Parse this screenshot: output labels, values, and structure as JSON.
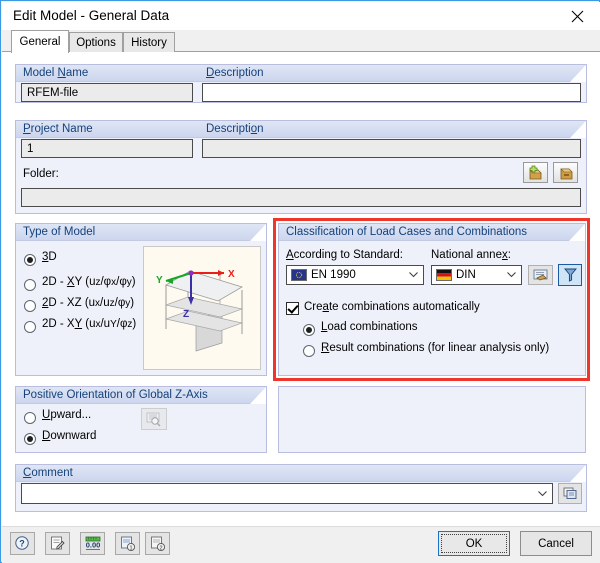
{
  "window": {
    "title": "Edit Model - General Data",
    "close_icon": "close-icon"
  },
  "tabs": [
    {
      "label": "General",
      "active": true
    },
    {
      "label": "Options",
      "active": false
    },
    {
      "label": "History",
      "active": false
    }
  ],
  "model": {
    "name_label": "Model Name",
    "name_value": "RFEM-file",
    "description_label": "Description",
    "description_value": ""
  },
  "project": {
    "name_label": "Project Name",
    "name_value": "1",
    "description_label": "Description",
    "description_value": "",
    "folder_label": "Folder:",
    "folder_value": "",
    "new_folder_icon": "new-folder-icon",
    "browse_folder_icon": "folder-box-icon"
  },
  "type_of_model": {
    "title": "Type of Model",
    "options": [
      {
        "label": "3D",
        "selected": true
      },
      {
        "label": "2D - XY (uz/φx/φy)",
        "selected": false
      },
      {
        "label": "2D - XZ (ux/uz/φy)",
        "selected": false
      },
      {
        "label": "2D - XY (ux/uy/φz)",
        "selected": false
      }
    ],
    "preview_axes": {
      "x": "X",
      "y": "Y",
      "z": "Z"
    }
  },
  "classification": {
    "title": "Classification of Load Cases and Combinations",
    "standard_label": "According to Standard:",
    "standard_value": "EN 1990",
    "standard_icon": "eu-flag-icon",
    "annex_label": "National annex:",
    "annex_value": "DIN",
    "annex_icon": "germany-flag-icon",
    "edit_annex_icon": "edit-annex-icon",
    "filter_icon": "filter-icon",
    "auto_checkbox_label": "Create combinations automatically",
    "auto_checked": true,
    "combination_options": [
      {
        "label": "Load combinations",
        "selected": true
      },
      {
        "label": "Result combinations (for linear analysis only)",
        "selected": false
      }
    ],
    "highlight_color": "#f0352c"
  },
  "z_axis": {
    "title": "Positive Orientation of Global Z-Axis",
    "options": [
      {
        "label": "Upward...",
        "selected": false
      },
      {
        "label": "Downward",
        "selected": true
      }
    ],
    "preview_icon": "preview-magnifier-icon"
  },
  "comment": {
    "label": "Comment",
    "value": "",
    "dropdown_icon": "chevron-down-icon",
    "library_icon": "comment-library-icon"
  },
  "footer": {
    "tools": [
      {
        "name": "help-icon",
        "glyph": "?"
      },
      {
        "name": "edit-note-icon",
        "glyph": "✎"
      },
      {
        "name": "units-icon",
        "glyph": "0.00"
      },
      {
        "name": "import-icon",
        "glyph": "↓"
      },
      {
        "name": "export-icon",
        "glyph": "↑"
      }
    ],
    "ok_label": "OK",
    "cancel_label": "Cancel"
  }
}
